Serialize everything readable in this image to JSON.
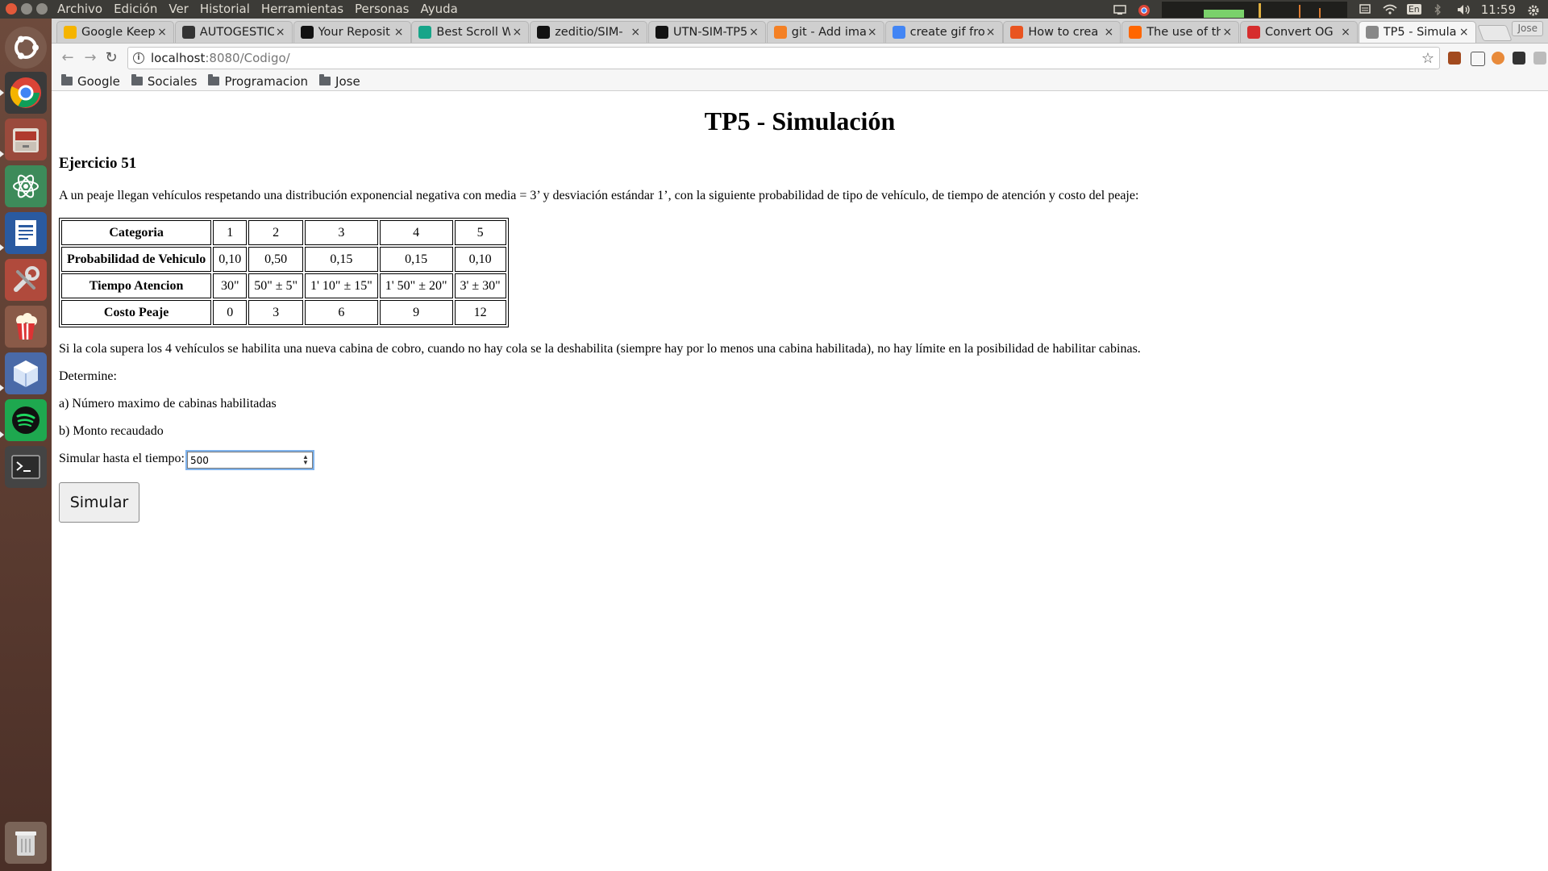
{
  "menu": [
    "Archivo",
    "Edición",
    "Ver",
    "Historial",
    "Herramientas",
    "Personas",
    "Ayuda"
  ],
  "indicators": {
    "keyboard": "En",
    "clock": "11:59"
  },
  "tabs": [
    {
      "label": "Google Keep",
      "icon": "keep-icon",
      "color": "#f5b400"
    },
    {
      "label": "AUTOGESTIC",
      "icon": "autogestion-icon",
      "color": "#333333"
    },
    {
      "label": "Your Reposit",
      "icon": "github-icon",
      "color": "#111111"
    },
    {
      "label": "Best Scroll W",
      "icon": "scroll-icon",
      "color": "#17a589"
    },
    {
      "label": "zeditio/SIM-",
      "icon": "github-icon",
      "color": "#111111"
    },
    {
      "label": "UTN-SIM-TP5",
      "icon": "github-icon",
      "color": "#111111"
    },
    {
      "label": "git - Add ima",
      "icon": "stackoverflow-icon",
      "color": "#f48024"
    },
    {
      "label": "create gif fro",
      "icon": "google-icon",
      "color": "#4285f4"
    },
    {
      "label": "How to crea",
      "icon": "askubuntu-icon",
      "color": "#e95420"
    },
    {
      "label": "The use of th",
      "icon": "hackernews-icon",
      "color": "#ff6600"
    },
    {
      "label": "Convert OG",
      "icon": "convert-icon",
      "color": "#d62d2d"
    },
    {
      "label": "TP5 - Simula",
      "icon": "page-icon",
      "color": "#888888",
      "active": true
    }
  ],
  "profile": "Jose",
  "address": {
    "host": "localhost",
    "rest": ":8080/Codigo/"
  },
  "bookmarks": [
    "Google",
    "Sociales",
    "Programacion",
    "Jose"
  ],
  "page": {
    "title": "TP5 - Simulación",
    "exercise": "Ejercicio 51",
    "intro": "A un peaje llegan vehículos respetando una distribución exponencial negativa con media = 3’ y desviación estándar 1’, con la siguiente probabilidad de tipo de vehículo, de tiempo de atención y costo del peaje:",
    "table": {
      "rows": [
        {
          "header": "Categoria",
          "cells": [
            "1",
            "2",
            "3",
            "4",
            "5"
          ]
        },
        {
          "header": "Probabilidad de Vehiculo",
          "cells": [
            "0,10",
            "0,50",
            "0,15",
            "0,15",
            "0,10"
          ]
        },
        {
          "header": "Tiempo Atencion",
          "cells": [
            "30\"",
            "50\" ± 5\"",
            "1' 10\" ± 15\"",
            "1' 50\" ± 20\"",
            "3' ± 30\""
          ]
        },
        {
          "header": "Costo Peaje",
          "cells": [
            "0",
            "3",
            "6",
            "9",
            "12"
          ]
        }
      ]
    },
    "rule": "Si la cola supera los 4 vehículos se habilita una nueva cabina de cobro, cuando no hay cola se la deshabilita (siempre hay por lo menos una cabina habilitada), no hay límite en la posibilidad de habilitar cabinas.",
    "determine": "Determine:",
    "question_a": "a) Número maximo de cabinas habilitadas",
    "question_b": "b) Monto recaudado",
    "sim_label": "Simular hasta el tiempo:",
    "sim_value": "500",
    "button": "Simular"
  }
}
